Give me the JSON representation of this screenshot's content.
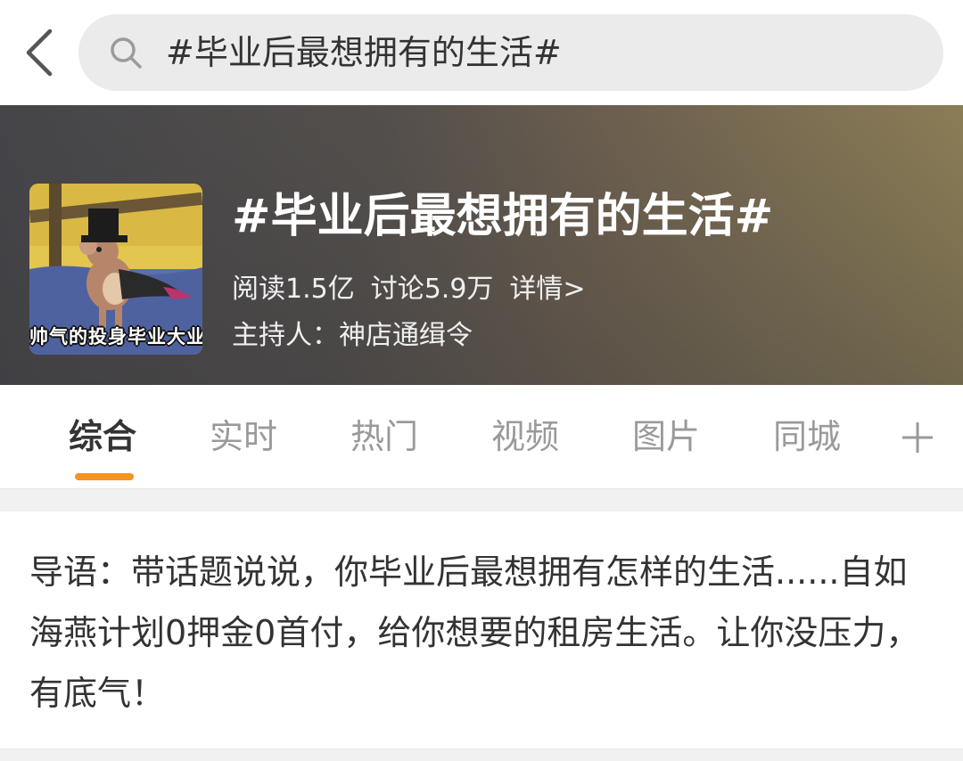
{
  "search": {
    "query": "#毕业后最想拥有的生活#",
    "back_icon": "chevron-left-icon",
    "search_icon": "search-icon"
  },
  "topic": {
    "title": "#毕业后最想拥有的生活#",
    "avatar_caption": "帅气的投身毕业大业",
    "reads": "阅读1.5亿",
    "discussions": "讨论5.9万",
    "details": "详情>",
    "host": "主持人：神店通缉令"
  },
  "tabs": [
    {
      "label": "综合",
      "active": true
    },
    {
      "label": "实时",
      "active": false
    },
    {
      "label": "热门",
      "active": false
    },
    {
      "label": "视频",
      "active": false
    },
    {
      "label": "图片",
      "active": false
    },
    {
      "label": "同城",
      "active": false
    }
  ],
  "tabs_more_icon": "plus-icon",
  "intro": {
    "text": "导语：带话题说说，你毕业后最想拥有怎样的生活......自如海燕计划0押金0首付，给你想要的租房生活。让你没压力，有底气！"
  },
  "colors": {
    "accent": "#f7931e",
    "tab_inactive": "#9a9a9a",
    "search_bg": "#ebebeb"
  }
}
